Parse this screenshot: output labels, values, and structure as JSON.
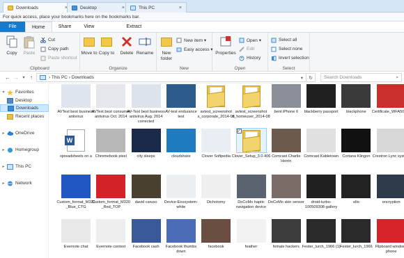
{
  "browser": {
    "tabs": [
      {
        "label": "Downloads",
        "active": true
      },
      {
        "label": "Desktop",
        "active": false
      },
      {
        "label": "This PC",
        "active": false
      }
    ],
    "close_glyph": "×",
    "bookmarks_hint": "For quick access, place your bookmarks here on the bookmarks bar."
  },
  "ribbon_tabs": {
    "file": "File",
    "home": "Home",
    "share": "Share",
    "view": "View",
    "manage": "Extract"
  },
  "ribbon": {
    "clipboard": {
      "label": "Clipboard",
      "copy": "Copy",
      "paste": "Paste",
      "cut": "Cut",
      "copy_path": "Copy path",
      "paste_shortcut": "Paste shortcut"
    },
    "organize": {
      "label": "Organize",
      "move_to": "Move to",
      "copy_to": "Copy to",
      "delete": "Delete",
      "rename": "Rename"
    },
    "new": {
      "label": "New",
      "new_folder": "New folder",
      "new_item": "New item ▾",
      "easy_access": "Easy access ▾"
    },
    "open": {
      "label": "Open",
      "properties": "Properties",
      "open": "Open ▾",
      "edit": "Edit",
      "history": "History"
    },
    "select": {
      "label": "Select",
      "select_all": "Select all",
      "select_none": "Select none",
      "invert": "Invert selection"
    }
  },
  "address": {
    "back": "←",
    "forward": "→",
    "recent": "▾",
    "up": "↑",
    "path": "› This PC › Downloads",
    "dropdown": "▾",
    "refresh": "↻",
    "search_placeholder": "Search Downloads",
    "search_icon": "⌕"
  },
  "navpane": {
    "quick_access": "Favorites",
    "desktop": "Desktop",
    "downloads": "Downloads",
    "recent": "Recent places",
    "onedrive": "OneDrive",
    "homegroup": "Homegroup",
    "this_pc": "This PC",
    "network": "Network",
    "expand_glyph": "▸",
    "expanded_glyph": "▾"
  },
  "files": {
    "row1": [
      {
        "name": "AVTest best business antivirus",
        "color": "#dfe6ee"
      },
      {
        "name": "AVTest best consumer antivirus Oct. 2014",
        "color": "#e4e8ec"
      },
      {
        "name": "AV-Test best business antivirus Aug. 2014 corrected",
        "color": "#dde3ea"
      },
      {
        "name": "AV-test endurance test",
        "color": "#2b5c8a"
      },
      {
        "name": "avtest_screenshot s_corporate_2014-08",
        "color": "folder"
      },
      {
        "name": "avtest_screenshot s_homeuser_2014-08",
        "color": "folder"
      },
      {
        "name": "bent iPhone 6",
        "color": "#8a8f98"
      },
      {
        "name": "blackberry passport",
        "color": "#202020"
      },
      {
        "name": "blackphone",
        "color": "#3a3a3a"
      },
      {
        "name": "Certificate_WFA50235",
        "color": "#c9302c"
      }
    ],
    "row2": [
      {
        "name": "spreadsheets on a",
        "color": "word"
      },
      {
        "name": "Chromebook pixel",
        "color": "#b8b8b8"
      },
      {
        "name": "city sleeps",
        "color": "#1b2a4a"
      },
      {
        "name": "cloudshare",
        "color": "#1e7bbf"
      },
      {
        "name": "Clover Softpedia",
        "color": "#e9eef4"
      },
      {
        "name": "Clover_Setup_3.0.406",
        "color": "folder"
      },
      {
        "name": "Comcast Charlie Herrin",
        "color": "#6b5a4e"
      },
      {
        "name": "Comcast Kabletown",
        "color": "#e0e0e0"
      },
      {
        "name": "Cortana Klingon",
        "color": "#111111"
      },
      {
        "name": "Crestron Lync system",
        "color": "#d8d8d8"
      }
    ],
    "row3": [
      {
        "name": "Custom_format_M320_Blue_CTG",
        "color": "#1f56c2"
      },
      {
        "name": "Custom_format_M320_Red_TOP",
        "color": "#d32228"
      },
      {
        "name": "david caruso",
        "color": "#4a4030"
      },
      {
        "name": "Device-Ecosystem-white",
        "color": "#eceff2"
      },
      {
        "name": "Dichotomy",
        "color": "#f0f0f0"
      },
      {
        "name": "DoCoMo haptic navigation device",
        "color": "#5a6470"
      },
      {
        "name": "DoCoMo skin sensor",
        "color": "#7a6c66"
      },
      {
        "name": "droid-turbo-100509308-gallery",
        "color": "#202020"
      },
      {
        "name": "ello",
        "color": "#222222"
      },
      {
        "name": "encryption",
        "color": "#2d3a4a"
      }
    ],
    "row4": [
      {
        "name": "Evernote chat",
        "color": "#e8e8e8"
      },
      {
        "name": "Evernote context",
        "color": "#eeeeee"
      },
      {
        "name": "Facebook cash",
        "color": "#3b5998"
      },
      {
        "name": "Facebook thumbs down",
        "color": "#4b6cb7"
      },
      {
        "name": "facebook",
        "color": "#6a4e42"
      },
      {
        "name": "feather",
        "color": "#f2f2f2"
      },
      {
        "name": "female hackers",
        "color": "#3c3c3c"
      },
      {
        "name": "Fester_lurch_1966 (1)",
        "color": "#2a2a2a"
      },
      {
        "name": "Fester_lurch_1966",
        "color": "#2a2a2a"
      },
      {
        "name": "Flipboard windows phone",
        "color": "#d8232a"
      }
    ],
    "selected": "Clover_Setup_3.0.406",
    "checkmark": "✓"
  }
}
